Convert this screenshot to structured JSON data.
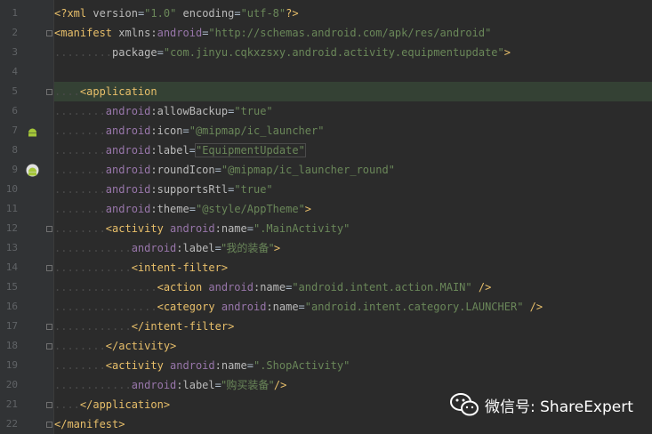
{
  "lines": [
    {
      "n": "1",
      "tokens": [
        {
          "c": "p",
          "t": "<?xml "
        },
        {
          "c": "a",
          "t": "version"
        },
        {
          "c": "tx",
          "t": "="
        },
        {
          "c": "s",
          "t": "\"1.0\""
        },
        {
          "c": "tx",
          "t": " "
        },
        {
          "c": "a",
          "t": "encoding"
        },
        {
          "c": "tx",
          "t": "="
        },
        {
          "c": "s",
          "t": "\"utf-8\""
        },
        {
          "c": "p",
          "t": "?>"
        }
      ]
    },
    {
      "n": "2",
      "tokens": [
        {
          "c": "t",
          "t": "<manifest "
        },
        {
          "c": "a",
          "t": "xmlns:"
        },
        {
          "c": "n",
          "t": "android"
        },
        {
          "c": "tx",
          "t": "="
        },
        {
          "c": "s",
          "t": "\"http://schemas.android.com/apk/res/android\""
        }
      ]
    },
    {
      "n": "3",
      "tokens": [
        {
          "c": "dots",
          "t": "........."
        },
        {
          "c": "a",
          "t": "package"
        },
        {
          "c": "tx",
          "t": "="
        },
        {
          "c": "s",
          "t": "\"com.jinyu.cqkxzsxy.android.activity.equipmentupdate\""
        },
        {
          "c": "t",
          "t": ">"
        }
      ]
    },
    {
      "n": "4",
      "tokens": []
    },
    {
      "n": "5",
      "tokens": [
        {
          "c": "dots",
          "t": "...."
        },
        {
          "c": "t",
          "t": "<application"
        }
      ]
    },
    {
      "n": "6",
      "tokens": [
        {
          "c": "dots",
          "t": "........"
        },
        {
          "c": "n",
          "t": "android"
        },
        {
          "c": "a",
          "t": ":allowBackup"
        },
        {
          "c": "tx",
          "t": "="
        },
        {
          "c": "s",
          "t": "\"true\""
        }
      ]
    },
    {
      "n": "7",
      "tokens": [
        {
          "c": "dots",
          "t": "........"
        },
        {
          "c": "n",
          "t": "android"
        },
        {
          "c": "a",
          "t": ":icon"
        },
        {
          "c": "tx",
          "t": "="
        },
        {
          "c": "s",
          "t": "\"@mipmap/ic_launcher\""
        }
      ]
    },
    {
      "n": "8",
      "tokens": [
        {
          "c": "dots",
          "t": "........"
        },
        {
          "c": "n",
          "t": "android"
        },
        {
          "c": "a",
          "t": ":label"
        },
        {
          "c": "tx",
          "t": "="
        },
        {
          "c": "s",
          "t": "\"EquipmentUpdate\""
        }
      ]
    },
    {
      "n": "9",
      "tokens": [
        {
          "c": "dots",
          "t": "........"
        },
        {
          "c": "n",
          "t": "android"
        },
        {
          "c": "a",
          "t": ":roundIcon"
        },
        {
          "c": "tx",
          "t": "="
        },
        {
          "c": "s",
          "t": "\"@mipmap/ic_launcher_round\""
        }
      ]
    },
    {
      "n": "10",
      "tokens": [
        {
          "c": "dots",
          "t": "........"
        },
        {
          "c": "n",
          "t": "android"
        },
        {
          "c": "a",
          "t": ":supportsRtl"
        },
        {
          "c": "tx",
          "t": "="
        },
        {
          "c": "s",
          "t": "\"true\""
        }
      ]
    },
    {
      "n": "11",
      "tokens": [
        {
          "c": "dots",
          "t": "........"
        },
        {
          "c": "n",
          "t": "android"
        },
        {
          "c": "a",
          "t": ":theme"
        },
        {
          "c": "tx",
          "t": "="
        },
        {
          "c": "s",
          "t": "\"@style/AppTheme\""
        },
        {
          "c": "t",
          "t": ">"
        }
      ]
    },
    {
      "n": "12",
      "tokens": [
        {
          "c": "dots",
          "t": "........"
        },
        {
          "c": "t",
          "t": "<activity "
        },
        {
          "c": "n",
          "t": "android"
        },
        {
          "c": "a",
          "t": ":name"
        },
        {
          "c": "tx",
          "t": "="
        },
        {
          "c": "s",
          "t": "\".MainActivity\""
        }
      ]
    },
    {
      "n": "13",
      "tokens": [
        {
          "c": "dots",
          "t": "............"
        },
        {
          "c": "n",
          "t": "android"
        },
        {
          "c": "a",
          "t": ":label"
        },
        {
          "c": "tx",
          "t": "="
        },
        {
          "c": "s",
          "t": "\"我的装备\""
        },
        {
          "c": "t",
          "t": ">"
        }
      ]
    },
    {
      "n": "14",
      "tokens": [
        {
          "c": "dots",
          "t": "............"
        },
        {
          "c": "t",
          "t": "<intent-filter>"
        }
      ]
    },
    {
      "n": "15",
      "tokens": [
        {
          "c": "dots",
          "t": "................"
        },
        {
          "c": "t",
          "t": "<action "
        },
        {
          "c": "n",
          "t": "android"
        },
        {
          "c": "a",
          "t": ":name"
        },
        {
          "c": "tx",
          "t": "="
        },
        {
          "c": "s",
          "t": "\"android.intent.action.MAIN\""
        },
        {
          "c": "t",
          "t": " />"
        }
      ]
    },
    {
      "n": "16",
      "tokens": [
        {
          "c": "dots",
          "t": "................"
        },
        {
          "c": "t",
          "t": "<category "
        },
        {
          "c": "n",
          "t": "android"
        },
        {
          "c": "a",
          "t": ":name"
        },
        {
          "c": "tx",
          "t": "="
        },
        {
          "c": "s",
          "t": "\"android.intent.category.LAUNCHER\""
        },
        {
          "c": "t",
          "t": " />"
        }
      ]
    },
    {
      "n": "17",
      "tokens": [
        {
          "c": "dots",
          "t": "............"
        },
        {
          "c": "t",
          "t": "</intent-filter>"
        }
      ]
    },
    {
      "n": "18",
      "tokens": [
        {
          "c": "dots",
          "t": "........"
        },
        {
          "c": "t",
          "t": "</activity>"
        }
      ]
    },
    {
      "n": "19",
      "tokens": [
        {
          "c": "dots",
          "t": "........"
        },
        {
          "c": "t",
          "t": "<activity "
        },
        {
          "c": "n",
          "t": "android"
        },
        {
          "c": "a",
          "t": ":name"
        },
        {
          "c": "tx",
          "t": "="
        },
        {
          "c": "s",
          "t": "\".ShopActivity\""
        }
      ]
    },
    {
      "n": "20",
      "tokens": [
        {
          "c": "dots",
          "t": "............"
        },
        {
          "c": "n",
          "t": "android"
        },
        {
          "c": "a",
          "t": ":label"
        },
        {
          "c": "tx",
          "t": "="
        },
        {
          "c": "s",
          "t": "\"购买装备\""
        },
        {
          "c": "t",
          "t": "/>"
        }
      ]
    },
    {
      "n": "21",
      "tokens": [
        {
          "c": "dots",
          "t": "...."
        },
        {
          "c": "t",
          "t": "</application>"
        }
      ]
    },
    {
      "n": "22",
      "tokens": [
        {
          "c": "t",
          "t": "</manifest>"
        }
      ]
    }
  ],
  "gutter_icons": [
    {
      "line": "7",
      "icon": "android-icon"
    },
    {
      "line": "9",
      "icon": "android-round-icon"
    }
  ],
  "highlighted_line": "5",
  "watermark": {
    "text": "微信号: ShareExpert",
    "icon": "wechat-logo-icon"
  },
  "colors": {
    "background": "#2b2b2b",
    "gutter": "#313335",
    "tag": "#e8bf6a",
    "attribute": "#bababa",
    "namespace": "#9876aa",
    "string": "#6a8759",
    "line_number": "#606366",
    "android_green": "#a4c639"
  }
}
